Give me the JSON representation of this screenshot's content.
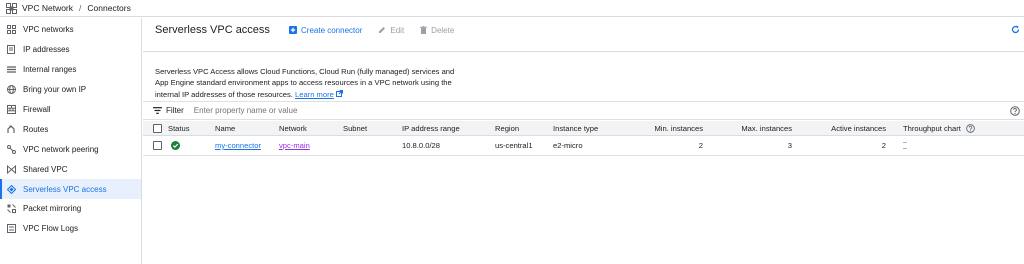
{
  "breadcrumb": {
    "root": "VPC Network",
    "separator": "/",
    "current": "Connectors"
  },
  "sidebar": {
    "items": [
      {
        "label": "VPC networks",
        "icon": "vpc-networks-icon"
      },
      {
        "label": "IP addresses",
        "icon": "ip-addresses-icon"
      },
      {
        "label": "Internal ranges",
        "icon": "internal-ranges-icon"
      },
      {
        "label": "Bring your own IP",
        "icon": "globe-icon"
      },
      {
        "label": "Firewall",
        "icon": "firewall-icon"
      },
      {
        "label": "Routes",
        "icon": "routes-icon"
      },
      {
        "label": "VPC network peering",
        "icon": "peering-icon"
      },
      {
        "label": "Shared VPC",
        "icon": "shared-vpc-icon"
      },
      {
        "label": "Serverless VPC access",
        "icon": "serverless-icon",
        "active": true
      },
      {
        "label": "Packet mirroring",
        "icon": "packet-mirroring-icon"
      },
      {
        "label": "VPC Flow Logs",
        "icon": "flow-logs-icon"
      }
    ]
  },
  "toolbar": {
    "title": "Serverless VPC access",
    "create_label": "Create connector",
    "edit_label": "Edit",
    "delete_label": "Delete"
  },
  "description": {
    "text": "Serverless VPC Access allows Cloud Functions, Cloud Run (fully managed) services and App Engine standard environment apps to access resources in a VPC network using the internal IP addresses of those resources.",
    "link": "Learn more"
  },
  "filter": {
    "label": "Filter",
    "placeholder": "Enter property name or value"
  },
  "table": {
    "columns": {
      "status": "Status",
      "name": "Name",
      "network": "Network",
      "subnet": "Subnet",
      "ip_range": "IP address range",
      "region": "Region",
      "instance_type": "Instance type",
      "min_instances": "Min. instances",
      "max_instances": "Max. instances",
      "active_instances": "Active instances",
      "throughput": "Throughput chart"
    },
    "rows": [
      {
        "status": "ok",
        "name": "my-connector",
        "network": "vpc-main",
        "subnet": "",
        "ip_range": "10.8.0.0/28",
        "region": "us-central1",
        "instance_type": "e2-micro",
        "min_instances": "2",
        "max_instances": "3",
        "active_instances": "2",
        "throughput": "–"
      }
    ]
  },
  "colors": {
    "accent": "#1a73e8",
    "success": "#188038",
    "network_link": "#9334e6"
  }
}
